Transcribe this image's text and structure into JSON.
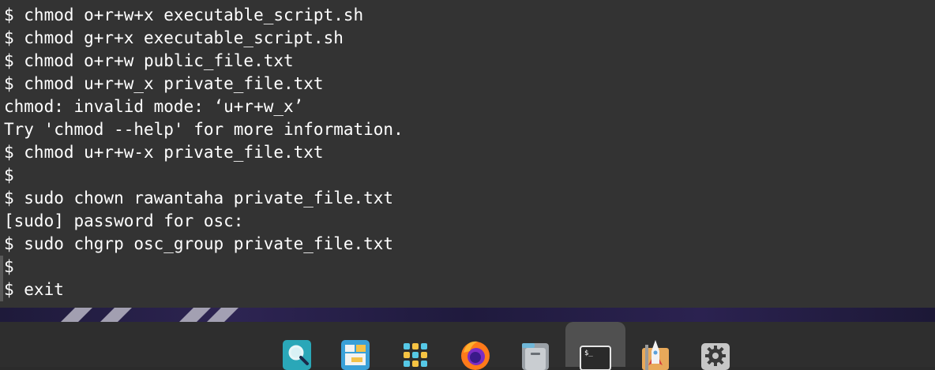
{
  "terminal": {
    "clipped_top_line": "$ chmod ... _ ... ... . ... (...)",
    "lines": [
      "$ chmod o+r+w+x executable_script.sh",
      "$ chmod g+r+x executable_script.sh",
      "$ chmod o+r+w public_file.txt",
      "$ chmod u+r+w_x private_file.txt",
      "chmod: invalid mode: ‘u+r+w_x’",
      "Try 'chmod --help' for more information.",
      "$ chmod u+r+w-x private_file.txt",
      "$",
      "$ sudo chown rawantaha private_file.txt",
      "[sudo] password for osc:",
      "$ sudo chgrp osc_group private_file.txt",
      "$",
      "$ exit"
    ]
  },
  "dock": {
    "items": [
      {
        "name": "Search",
        "icon": "magnifier-icon"
      },
      {
        "name": "Files Manager",
        "icon": "window-manager-icon"
      },
      {
        "name": "App Grid",
        "icon": "app-grid-icon"
      },
      {
        "name": "Firefox",
        "icon": "firefox-icon"
      },
      {
        "name": "Files",
        "icon": "folder-icon"
      },
      {
        "name": "Terminal",
        "icon": "terminal-icon",
        "active": true
      },
      {
        "name": "Builder",
        "icon": "rocket-icon"
      },
      {
        "name": "Settings",
        "icon": "gear-icon"
      }
    ]
  },
  "colors": {
    "terminal_bg": "#333333",
    "terminal_fg": "#ffffff",
    "dock_bg": "#2e2e2e",
    "dock_active": "#505050"
  }
}
